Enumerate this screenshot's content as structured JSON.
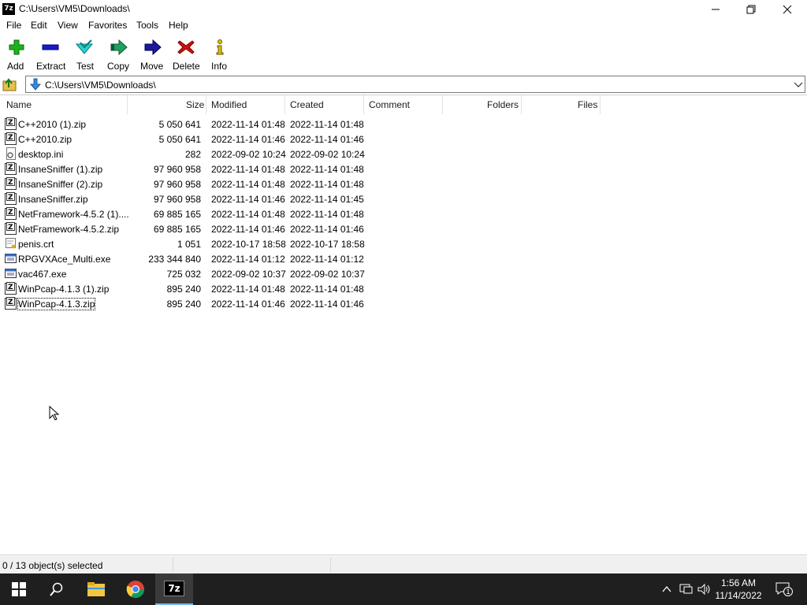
{
  "window": {
    "title": "C:\\Users\\VM5\\Downloads\\",
    "app_icon": "7z"
  },
  "menu": [
    "File",
    "Edit",
    "View",
    "Favorites",
    "Tools",
    "Help"
  ],
  "toolbar": [
    "Add",
    "Extract",
    "Test",
    "Copy",
    "Move",
    "Delete",
    "Info"
  ],
  "address": {
    "path": "C:\\Users\\VM5\\Downloads\\"
  },
  "columns": [
    "Name",
    "Size",
    "Modified",
    "Created",
    "Comment",
    "Folders",
    "Files"
  ],
  "files": [
    {
      "name": "C++2010 (1).zip",
      "size": "5 050 641",
      "modified": "2022-11-14 01:48",
      "created": "2022-11-14 01:48",
      "type": "zip"
    },
    {
      "name": "C++2010.zip",
      "size": "5 050 641",
      "modified": "2022-11-14 01:46",
      "created": "2022-11-14 01:46",
      "type": "zip"
    },
    {
      "name": "desktop.ini",
      "size": "282",
      "modified": "2022-09-02 10:24",
      "created": "2022-09-02 10:24",
      "type": "ini"
    },
    {
      "name": "InsaneSniffer (1).zip",
      "size": "97 960 958",
      "modified": "2022-11-14 01:48",
      "created": "2022-11-14 01:48",
      "type": "zip"
    },
    {
      "name": "InsaneSniffer (2).zip",
      "size": "97 960 958",
      "modified": "2022-11-14 01:48",
      "created": "2022-11-14 01:48",
      "type": "zip"
    },
    {
      "name": "InsaneSniffer.zip",
      "size": "97 960 958",
      "modified": "2022-11-14 01:46",
      "created": "2022-11-14 01:45",
      "type": "zip"
    },
    {
      "name": "NetFramework-4.5.2 (1)....",
      "size": "69 885 165",
      "modified": "2022-11-14 01:48",
      "created": "2022-11-14 01:48",
      "type": "zip"
    },
    {
      "name": "NetFramework-4.5.2.zip",
      "size": "69 885 165",
      "modified": "2022-11-14 01:46",
      "created": "2022-11-14 01:46",
      "type": "zip"
    },
    {
      "name": "penis.crt",
      "size": "1 051",
      "modified": "2022-10-17 18:58",
      "created": "2022-10-17 18:58",
      "type": "crt"
    },
    {
      "name": "RPGVXAce_Multi.exe",
      "size": "233 344 840",
      "modified": "2022-11-14 01:12",
      "created": "2022-11-14 01:12",
      "type": "exe"
    },
    {
      "name": "vac467.exe",
      "size": "725 032",
      "modified": "2022-09-02 10:37",
      "created": "2022-09-02 10:37",
      "type": "exe"
    },
    {
      "name": "WinPcap-4.1.3 (1).zip",
      "size": "895 240",
      "modified": "2022-11-14 01:48",
      "created": "2022-11-14 01:48",
      "type": "zip"
    },
    {
      "name": "WinPcap-4.1.3.zip",
      "size": "895 240",
      "modified": "2022-11-14 01:46",
      "created": "2022-11-14 01:46",
      "type": "zip",
      "focused": true
    }
  ],
  "status": {
    "text": "0 / 13 object(s) selected"
  },
  "taskbar": {
    "apps": [
      "start-icon",
      "search-icon",
      "file-explorer-icon",
      "chrome-icon",
      "7zip-icon"
    ],
    "time": "1:56 AM",
    "date": "11/14/2022",
    "notification_count": "1"
  }
}
